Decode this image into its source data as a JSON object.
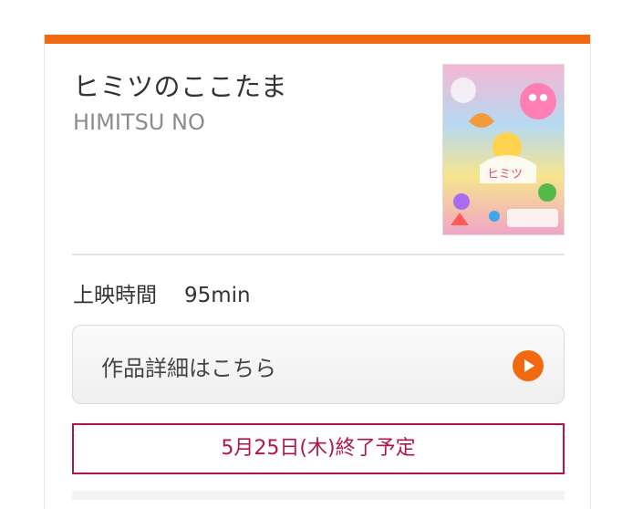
{
  "movie": {
    "title_ja": "ヒミツのここたま",
    "title_en": "HIMITSU NO",
    "poster_icon": "movie-poster-image"
  },
  "runtime": {
    "label": "上映時間",
    "value": "95min"
  },
  "details_button": {
    "label": "作品詳細はこちら",
    "icon": "play-arrow-icon"
  },
  "end_notice": {
    "text": "5月25日(木)終了予定"
  },
  "colors": {
    "accent": "#f26a10",
    "notice": "#b0164b",
    "divider": "#e2e2e2"
  }
}
